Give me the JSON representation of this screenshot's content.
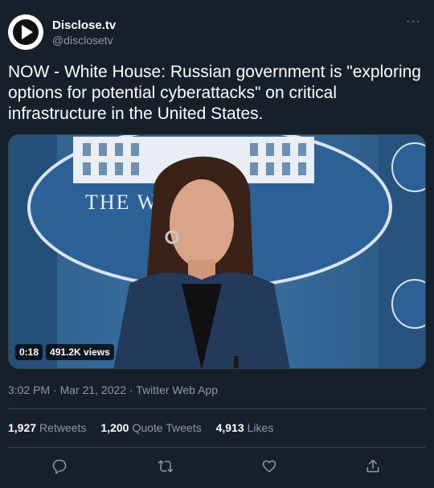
{
  "account": {
    "name": "Disclose.tv",
    "handle": "@disclosetv",
    "more_label": "···"
  },
  "tweet": {
    "text": "NOW - White House: Russian government is \"exploring options for potential cyberattacks\" on critical infrastructure in the United States."
  },
  "media": {
    "duration": "0:18",
    "views": "491.2K views",
    "backdrop_text": "THE W   HOUSE"
  },
  "meta": {
    "time": "3:02 PM",
    "separator": " · ",
    "date": "Mar 21, 2022",
    "source": "Twitter Web App"
  },
  "stats": {
    "retweets_count": "1,927",
    "retweets_label": "Retweets",
    "quotes_count": "1,200",
    "quotes_label": "Quote Tweets",
    "likes_count": "4,913",
    "likes_label": "Likes"
  },
  "colors": {
    "background": "#15202b",
    "secondary_text": "#8b98a5",
    "divider": "#38444d"
  },
  "icons": [
    "reply-icon",
    "retweet-icon",
    "like-icon",
    "share-icon"
  ]
}
